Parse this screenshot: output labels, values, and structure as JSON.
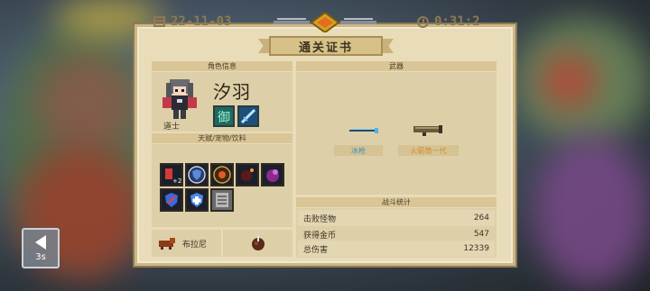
{
  "certificate": {
    "title": "通关证书",
    "date": "22-11-03",
    "time": "0:31:2"
  },
  "sections": {
    "character_info": "角色信息",
    "weapons": "武器",
    "buffs_pets_drinks": "天赋/宠物/饮料",
    "battle_stats": "战斗统计"
  },
  "character": {
    "name": "汐羽",
    "class": "道士"
  },
  "weapons": [
    {
      "name": "冰枪",
      "color": "#3e93b8"
    },
    {
      "name": "火箭筒一代",
      "color": "#d58a2a"
    }
  ],
  "pet": {
    "name": "布拉尼"
  },
  "stats": [
    {
      "label": "击败怪物",
      "value": "264"
    },
    {
      "label": "获得金币",
      "value": "547"
    },
    {
      "label": "总伤害",
      "value": "12339"
    }
  ],
  "back_button": {
    "countdown": "3s",
    "icon": "back-arrow-icon"
  },
  "colors": {
    "panel_bg": "#e9dcb9",
    "section_header": "#d9c596",
    "ice_gun": "#3e93b8",
    "rocket_launcher": "#d58a2a"
  }
}
